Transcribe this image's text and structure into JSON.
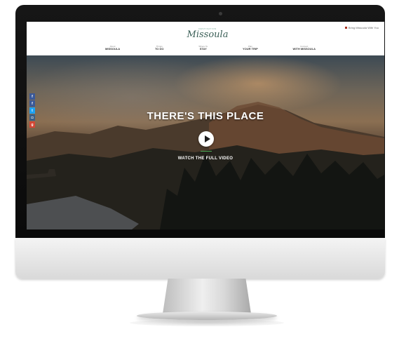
{
  "site": {
    "logo_kicker": "DESTINATION",
    "logo_name": "Missoula",
    "top_right": "Bring Missoula With You"
  },
  "nav": [
    {
      "sub": "About",
      "main": "MISSOULA"
    },
    {
      "sub": "Things",
      "main": "TO DO"
    },
    {
      "sub": "Where To",
      "main": "STAY"
    },
    {
      "sub": "Plan",
      "main": "YOUR TRIP"
    },
    {
      "sub": "Connect",
      "main": "WITH MISSOULA"
    }
  ],
  "hero": {
    "headline": "THERE'S THIS PLACE",
    "cta": "WATCH THE FULL VIDEO"
  },
  "social": [
    {
      "icon": "facebook-icon",
      "glyph": "f",
      "color": "#3b5998"
    },
    {
      "icon": "facebook-share-icon",
      "glyph": "f",
      "color": "#3b5998"
    },
    {
      "icon": "twitter-icon",
      "glyph": "t",
      "color": "#1da1f2"
    },
    {
      "icon": "instagram-icon",
      "glyph": "◘",
      "color": "#3b5f86"
    },
    {
      "icon": "google-plus-icon",
      "glyph": "g",
      "color": "#d34836"
    }
  ],
  "colors": {
    "accent": "#4caa55",
    "logo": "#3b5f57"
  }
}
